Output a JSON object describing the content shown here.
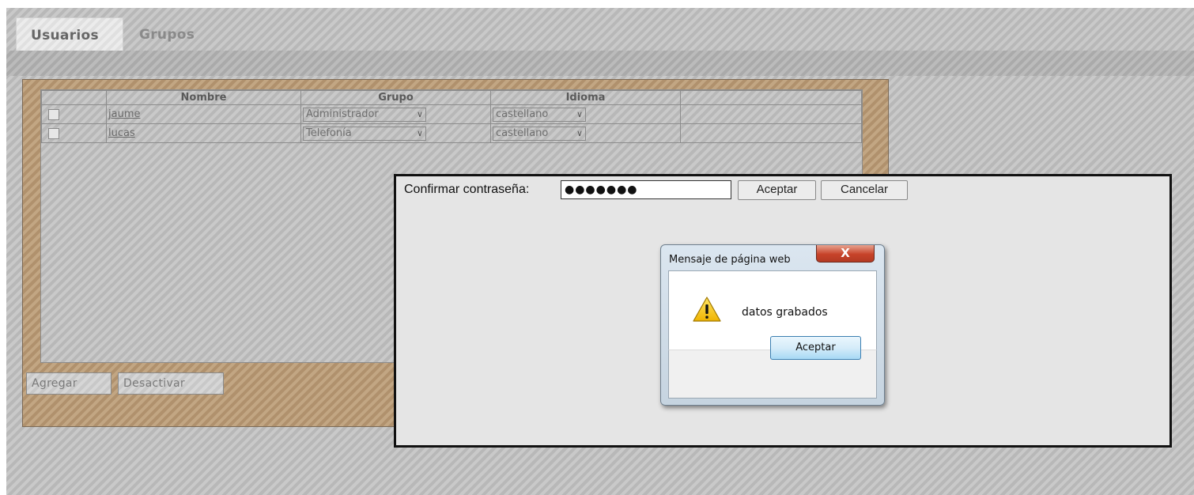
{
  "tabs": [
    {
      "label": "Usuarios"
    },
    {
      "label": "Grupos"
    }
  ],
  "table": {
    "columns": [
      "",
      "Nombre",
      "Grupo",
      "Idioma",
      ""
    ],
    "rows": [
      {
        "nombre": "jaume",
        "grupo": "Administrador",
        "idioma": "castellano"
      },
      {
        "nombre": "lucas",
        "grupo": "Telefonía",
        "idioma": "castellano"
      }
    ]
  },
  "panel_buttons": {
    "add": "Agregar",
    "deactivate": "Desactivar"
  },
  "confirm": {
    "label": "Confirmar contraseña:",
    "password_value": "●●●●●●●",
    "accept": "Aceptar",
    "cancel": "Cancelar"
  },
  "message_dialog": {
    "title": "Mensaje de página web",
    "close_glyph": "X",
    "text": "datos grabados",
    "accept": "Aceptar"
  },
  "colors": {
    "panel_border": "#7d6a55",
    "confirm_border": "#111111",
    "close_red": "#c7432a",
    "warning_yellow": "#f2c200"
  },
  "icons": {
    "warning": "warning-icon",
    "dropdown": "chevron-down-icon",
    "close": "close-icon"
  }
}
